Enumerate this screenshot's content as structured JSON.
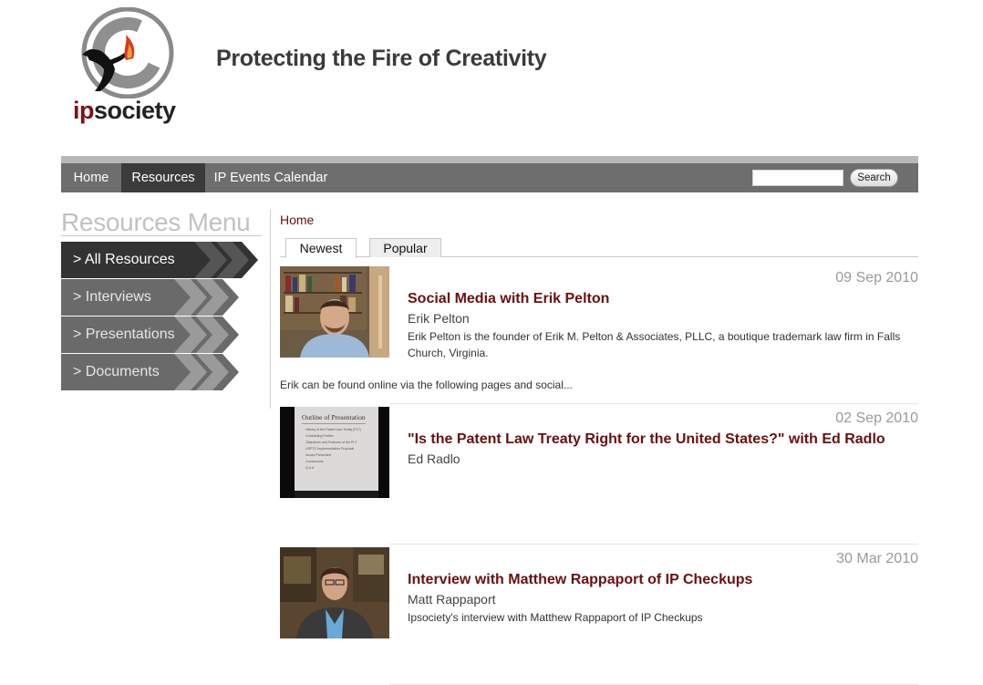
{
  "site": {
    "logo_word_ip": "ip",
    "logo_word_society": "society",
    "tagline": "Protecting the Fire of Creativity"
  },
  "nav": {
    "items": [
      {
        "label": "Home",
        "active": false
      },
      {
        "label": "Resources",
        "active": true
      },
      {
        "label": "IP Events Calendar",
        "active": false
      }
    ],
    "search_value": "",
    "search_button": "Search"
  },
  "menu": {
    "title": "Resources Menu",
    "items": [
      {
        "label": "> All Resources",
        "active": true
      },
      {
        "label": "> Interviews",
        "active": false
      },
      {
        "label": "> Presentations",
        "active": false
      },
      {
        "label": "> Documents",
        "active": false
      }
    ]
  },
  "breadcrumb": "Home",
  "tabs": [
    {
      "label": "Newest",
      "active": true
    },
    {
      "label": "Popular",
      "active": false
    }
  ],
  "resources": [
    {
      "date": "09 Sep 2010",
      "title": "Social Media with Erik Pelton",
      "author": "Erik Pelton",
      "description": "Erik Pelton is the founder of Erik M. Pelton & Associates, PLLC, a boutique trademark law firm in Falls Church, Virginia.",
      "excerpt": "Erik can be found online via the following pages and social..."
    },
    {
      "date": "02 Sep 2010",
      "title": "\"Is the Patent Law Treaty Right for the United States?\" with Ed Radlo",
      "author": "Ed Radlo",
      "slide_title": "Outline of Presentation",
      "slide_lines": [
        "History of the Patent Law Treaty (PLT)",
        "Contracting Parties",
        "Objectives and Features of the PLT",
        "USPTO Implementation Proposal",
        "Issues Presented",
        "Conclusions",
        "Q & A"
      ]
    },
    {
      "date": "30 Mar 2010",
      "title": "Interview with Matthew Rappaport of IP Checkups",
      "author": "Matt Rappaport",
      "description": "Ipsociety's interview with Matthew Rappaport of IP Checkups"
    }
  ],
  "colors": {
    "brand_dark_red": "#6b0f0f",
    "nav_bg": "#6e6e6e",
    "nav_active": "#3b3b3b",
    "menu_active": "#333333",
    "menu_inactive": "#6a6a6a"
  }
}
